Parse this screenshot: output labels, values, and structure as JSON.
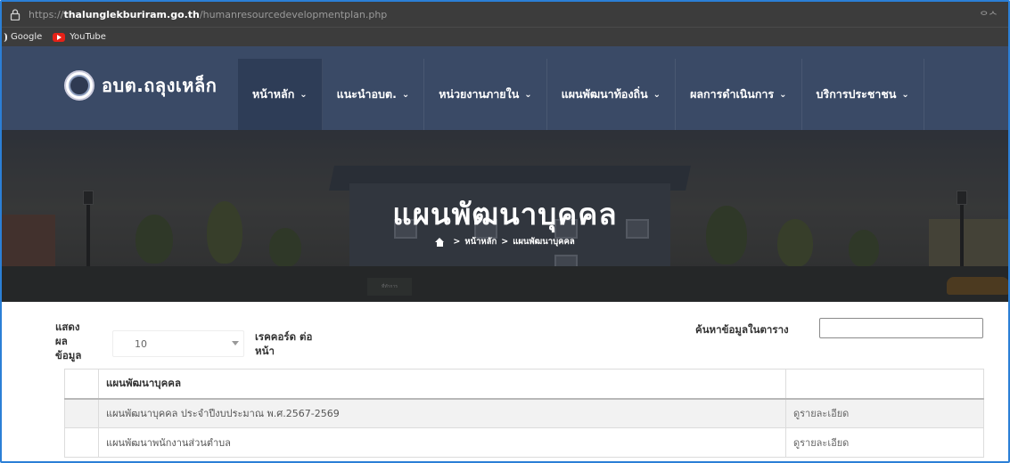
{
  "browser": {
    "url_scheme": "https://",
    "url_host": "thalunglekburiram.go.th",
    "url_path": "/humanresourcedevelopmentplan.php",
    "reader_text": "ᄋᄉ",
    "bookmarks": [
      {
        "label": "Google",
        "icon": "google-icon"
      },
      {
        "label": "YouTube",
        "icon": "youtube-icon"
      }
    ]
  },
  "site": {
    "logo_text": "อบต.ถลุงเหล็ก",
    "menu": [
      {
        "label": "หน้าหลัก",
        "active": true
      },
      {
        "label": "แนะนำอบต.",
        "active": false
      },
      {
        "label": "หน่วยงานภายใน",
        "active": false
      },
      {
        "label": "แผนพัฒนาท้องถิ่น",
        "active": false
      },
      {
        "label": "ผลการดำเนินการ",
        "active": false
      },
      {
        "label": "บริการประชาชน",
        "active": false
      }
    ],
    "chevron": "⌄"
  },
  "hero": {
    "title": "แผนพัฒนาบุคคล",
    "breadcrumb": [
      "หน้าหลัก",
      "แผนพัฒนาบุคคล"
    ],
    "breadcrumb_sep": ">",
    "sign_text": "ที่ทำการ"
  },
  "table_controls": {
    "length_label_1": "แสดง ผล ข้อมูล",
    "length_value": "10",
    "length_label_2": "เรคคอร์ด ต่อ หน้า",
    "search_label": "ค้นหาข้อมูลในตาราง",
    "search_value": ""
  },
  "table": {
    "header": "แผนพัฒนาบุคคล",
    "rows": [
      {
        "title": "แผนพัฒนาบุคคล ประจำปีงบประมาณ พ.ศ.2567-2569",
        "action": "ดูรายละเอียด"
      },
      {
        "title": "แผนพัฒนาพนักงานส่วนตำบล",
        "action": "ดูรายละเอียด"
      }
    ]
  }
}
